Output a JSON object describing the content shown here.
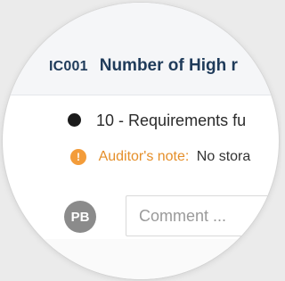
{
  "header": {
    "code": "IC001",
    "title": "Number of High r"
  },
  "requirement": {
    "text": "10 - Requirements fu"
  },
  "note": {
    "label": "Auditor's note:",
    "text": "No stora",
    "icon": "warning-icon",
    "color": "#f39c3a"
  },
  "comment": {
    "avatar_text": "PB",
    "placeholder": "Comment ..."
  }
}
